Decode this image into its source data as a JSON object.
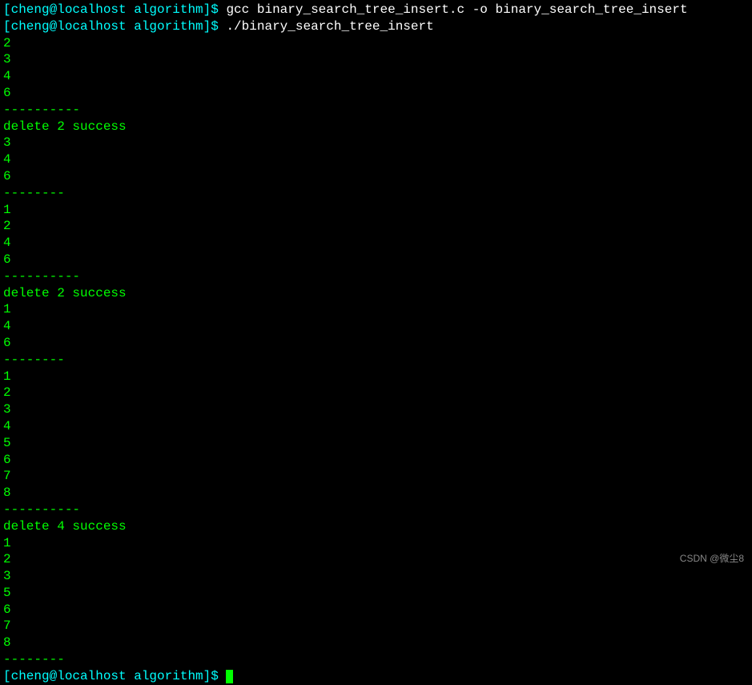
{
  "terminal": {
    "lines": [
      {
        "type": "prompt-cmd",
        "prompt": "[cheng@localhost algorithm]$ ",
        "command": "gcc binary_search_tree_insert.c -o binary_search_tree_insert"
      },
      {
        "type": "prompt-cmd",
        "prompt": "[cheng@localhost algorithm]$ ",
        "command": "./binary_search_tree_insert"
      },
      {
        "type": "output",
        "text": "2"
      },
      {
        "type": "output",
        "text": "3"
      },
      {
        "type": "output",
        "text": "4"
      },
      {
        "type": "output",
        "text": "6"
      },
      {
        "type": "output",
        "text": "----------"
      },
      {
        "type": "output",
        "text": "delete 2 success"
      },
      {
        "type": "output",
        "text": "3"
      },
      {
        "type": "output",
        "text": "4"
      },
      {
        "type": "output",
        "text": "6"
      },
      {
        "type": "output",
        "text": "--------"
      },
      {
        "type": "output",
        "text": "1"
      },
      {
        "type": "output",
        "text": "2"
      },
      {
        "type": "output",
        "text": "4"
      },
      {
        "type": "output",
        "text": "6"
      },
      {
        "type": "output",
        "text": "----------"
      },
      {
        "type": "output",
        "text": "delete 2 success"
      },
      {
        "type": "output",
        "text": "1"
      },
      {
        "type": "output",
        "text": "4"
      },
      {
        "type": "output",
        "text": "6"
      },
      {
        "type": "output",
        "text": "--------"
      },
      {
        "type": "output",
        "text": "1"
      },
      {
        "type": "output",
        "text": "2"
      },
      {
        "type": "output",
        "text": "3"
      },
      {
        "type": "output",
        "text": "4"
      },
      {
        "type": "output",
        "text": "5"
      },
      {
        "type": "output",
        "text": "6"
      },
      {
        "type": "output",
        "text": "7"
      },
      {
        "type": "output",
        "text": "8"
      },
      {
        "type": "output",
        "text": "----------"
      },
      {
        "type": "output",
        "text": "delete 4 success"
      },
      {
        "type": "output",
        "text": "1"
      },
      {
        "type": "output",
        "text": "2"
      },
      {
        "type": "output",
        "text": "3"
      },
      {
        "type": "output",
        "text": "5"
      },
      {
        "type": "output",
        "text": "6"
      },
      {
        "type": "output",
        "text": "7"
      },
      {
        "type": "output",
        "text": "8"
      },
      {
        "type": "output",
        "text": "--------"
      },
      {
        "type": "prompt-cursor",
        "prompt": "[cheng@localhost algorithm]$ "
      }
    ]
  },
  "watermark": "CSDN @微尘8"
}
